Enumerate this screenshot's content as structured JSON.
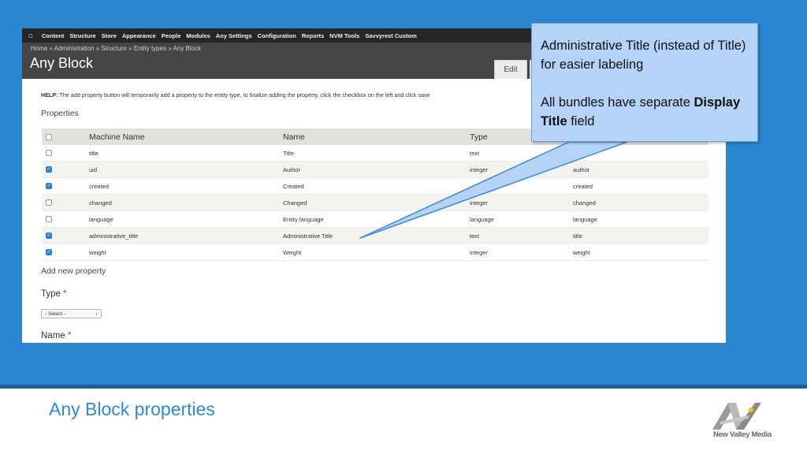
{
  "toolbar": {
    "home_icon": "home-icon",
    "items": [
      "Content",
      "Structure",
      "Store",
      "Appearance",
      "People",
      "Modules",
      "Any Settings",
      "Configuration",
      "Reports",
      "NVM Tools",
      "Savvyrest Custom"
    ]
  },
  "header": {
    "breadcrumb": "Home » Administration » Structure » Entity types » Any Block",
    "title": "Any Block",
    "tab_edit": "Edit"
  },
  "help": {
    "label": "HELP:",
    "text": " The add property button will temporarily add a property to the entity type, to finalize adding the property, click the checkbox on the left and click save"
  },
  "properties": {
    "section_title": "Properties",
    "columns": [
      "Machine Name",
      "Name",
      "Type"
    ],
    "rows": [
      {
        "checked": false,
        "machine": "title",
        "name": "Title",
        "type": "text",
        "extra": ""
      },
      {
        "checked": true,
        "machine": "uid",
        "name": "Author",
        "type": "integer",
        "extra": "author"
      },
      {
        "checked": true,
        "machine": "created",
        "name": "Created",
        "type": "",
        "extra": "created"
      },
      {
        "checked": false,
        "machine": "changed",
        "name": "Changed",
        "type": "integer",
        "extra": "changed"
      },
      {
        "checked": false,
        "machine": "language",
        "name": "Entity language",
        "type": "language",
        "extra": "language"
      },
      {
        "checked": true,
        "machine": "administrative_title",
        "name": "Administrative Title",
        "type": "text",
        "extra": "title"
      },
      {
        "checked": true,
        "machine": "weight",
        "name": "Weight",
        "type": "integer",
        "extra": "weight"
      }
    ]
  },
  "form": {
    "add_new_property": "Add new property",
    "type_label": "Type",
    "required_marker": "*",
    "select_value": "- Select -",
    "name_label": "Name"
  },
  "callout": {
    "line1": "Administrative Title (instead of Title) for easier labeling",
    "line2_prefix": "All bundles have separate ",
    "line2_bold": "Display Title",
    "line2_suffix": " field"
  },
  "slide": {
    "title": "Any Block properties",
    "logo_text": "New Valley Media",
    "accent_color": "#2a86d1",
    "callout_color": "#b4d3f7"
  }
}
